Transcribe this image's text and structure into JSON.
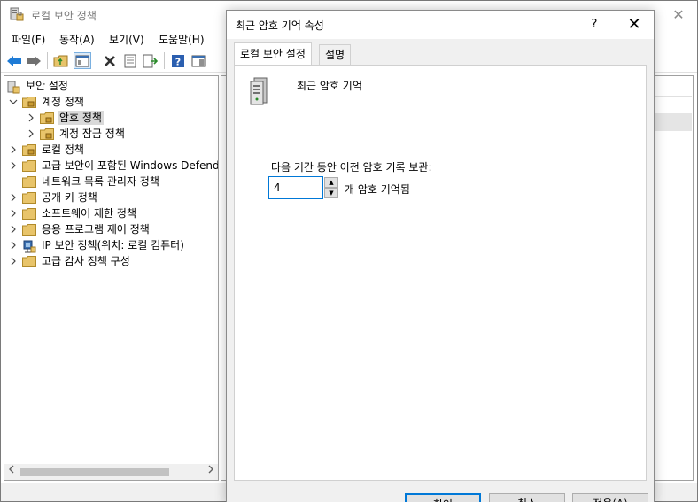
{
  "main_window": {
    "title": "로컬 보안 정책",
    "close_glyph": "✕"
  },
  "menu": [
    "파일(F)",
    "동작(A)",
    "보기(V)",
    "도움말(H)"
  ],
  "toolbar": {
    "icons": [
      "back-arrow-icon",
      "forward-arrow-icon",
      "up-folder-icon",
      "show-tree-icon",
      "delete-icon",
      "properties-icon",
      "export-list-icon",
      "help-icon",
      "action-pane-icon"
    ]
  },
  "tree": {
    "root": "보안 설정",
    "items": [
      {
        "label": "계정 정책",
        "expanded": true,
        "level": 1
      },
      {
        "label": "암호 정책",
        "level": 2,
        "selected": true
      },
      {
        "label": "계정 잠금 정책",
        "level": 2
      },
      {
        "label": "로컬 정책",
        "level": 1
      },
      {
        "label": "고급 보안이 포함된 Windows Defend",
        "level": 1
      },
      {
        "label": "네트워크 목록 관리자 정책",
        "level": 1
      },
      {
        "label": "공개 키 정책",
        "level": 1
      },
      {
        "label": "소프트웨어 제한 정책",
        "level": 1
      },
      {
        "label": "응용 프로그램 제어 정책",
        "level": 1
      },
      {
        "label": "IP 보안 정책(위치: 로컬 컴퓨터)",
        "level": 1
      },
      {
        "label": "고급 감사 정책 구성",
        "level": 1
      }
    ]
  },
  "dialog": {
    "title": "최근 암호 기억 속성",
    "help_glyph": "?",
    "close_glyph": "✕",
    "tabs": [
      "로컬 보안 설정",
      "설명"
    ],
    "policy_name": "최근 암호 기억",
    "description": "다음 기간 동안 이전 암호 기록 보관:",
    "value": "4",
    "unit": "개 암호 기억됨",
    "buttons": [
      "확인",
      "취소",
      "적용(A)"
    ]
  },
  "colors": {
    "accent": "#0078d7",
    "selection": "#d9d9d9",
    "folder": "#e8c46a"
  }
}
